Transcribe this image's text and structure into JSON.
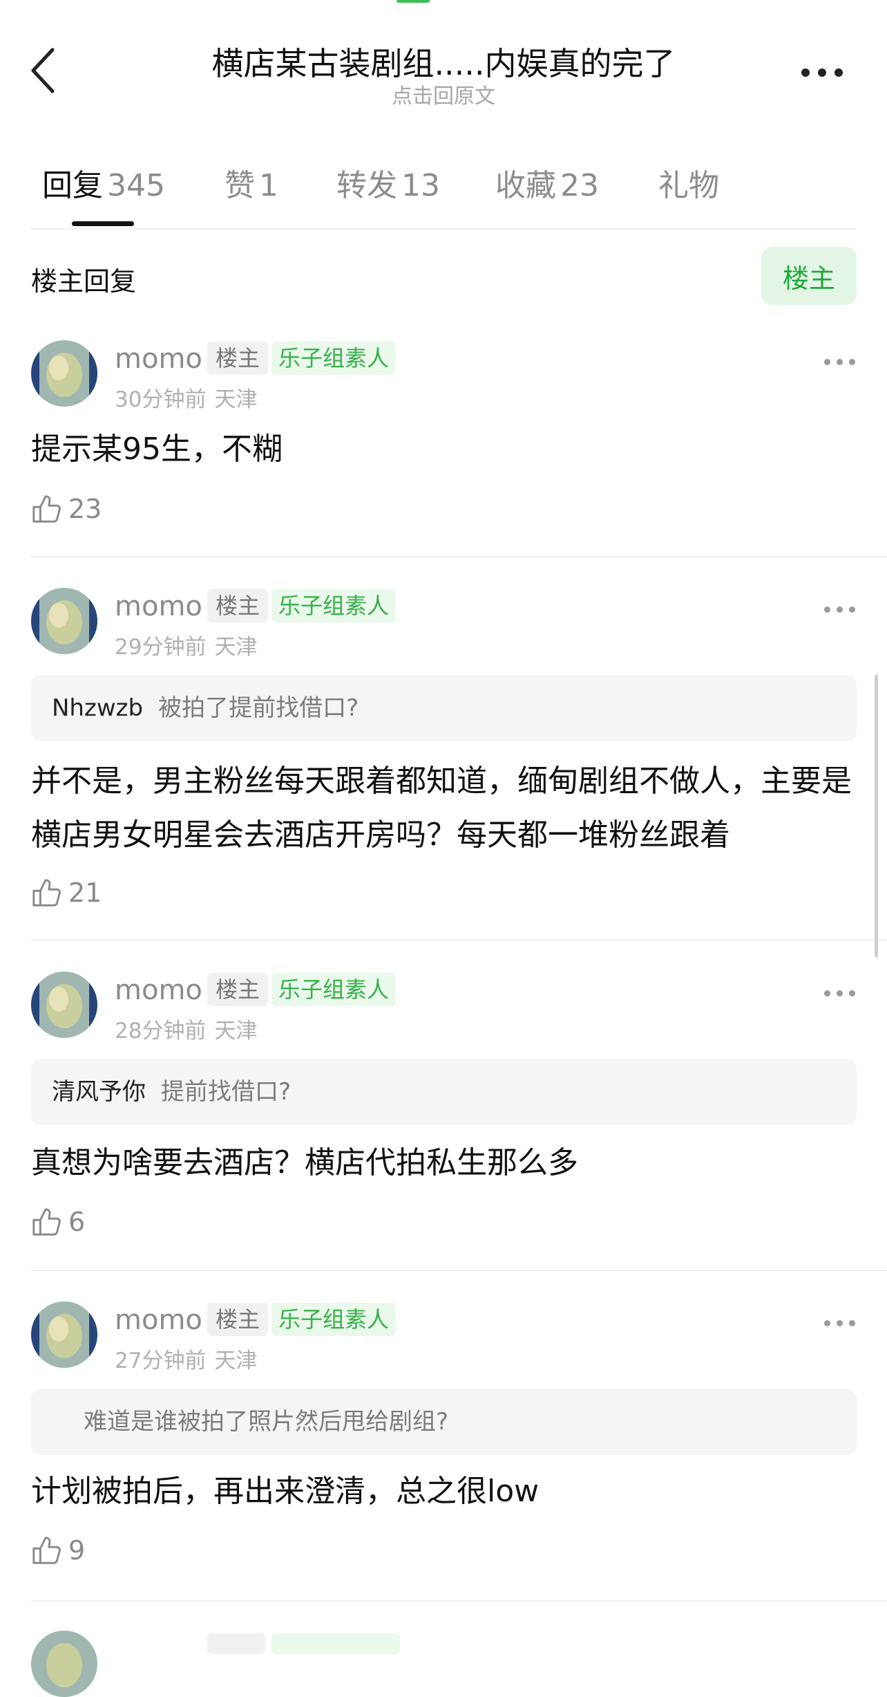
{
  "header": {
    "title": "横店某古装剧组.....内娱真的完了",
    "subtitle": "点击回原文"
  },
  "tabs": [
    {
      "name": "回复",
      "count": "345",
      "active": true
    },
    {
      "name": "赞",
      "count": "1",
      "active": false
    },
    {
      "name": "转发",
      "count": "13",
      "active": false
    },
    {
      "name": "收藏",
      "count": "23",
      "active": false
    },
    {
      "name": "礼物",
      "count": "",
      "active": false
    }
  ],
  "section": {
    "title": "楼主回复",
    "filter_label": "楼主"
  },
  "comments": [
    {
      "username": "momo",
      "owner_badge": "楼主",
      "group_badge": "乐子组素人",
      "time": "30分钟前",
      "location": "天津",
      "quote_user": "",
      "quote_text": "",
      "text": "提示某95生，不糊",
      "likes": "23"
    },
    {
      "username": "momo",
      "owner_badge": "楼主",
      "group_badge": "乐子组素人",
      "time": "29分钟前",
      "location": "天津",
      "quote_user": "Nhzwzb",
      "quote_text": "被拍了提前找借口?",
      "text": "并不是，男主粉丝每天跟着都知道，缅甸剧组不做人，主要是横店男女明星会去酒店开房吗？每天都一堆粉丝跟着",
      "likes": "21"
    },
    {
      "username": "momo",
      "owner_badge": "楼主",
      "group_badge": "乐子组素人",
      "time": "28分钟前",
      "location": "天津",
      "quote_user": "清风予你",
      "quote_text": "提前找借口?",
      "text": "真想为啥要去酒店？横店代拍私生那么多",
      "likes": "6"
    },
    {
      "username": "momo",
      "owner_badge": "楼主",
      "group_badge": "乐子组素人",
      "time": "27分钟前",
      "location": "天津",
      "quote_user": "",
      "quote_text": "难道是谁被拍了照片然后甩给剧组?",
      "text": "计划被拍后，再出来澄清，总之很low",
      "likes": "9"
    }
  ],
  "colors": {
    "accent_green": "#1fa83a",
    "badge_green_bg": "#ebf8ec",
    "filter_bg": "#e3f6e6"
  },
  "icons": {
    "back": "back-chevron-icon",
    "more": "more-horizontal-icon",
    "like": "thumbs-up-icon"
  }
}
